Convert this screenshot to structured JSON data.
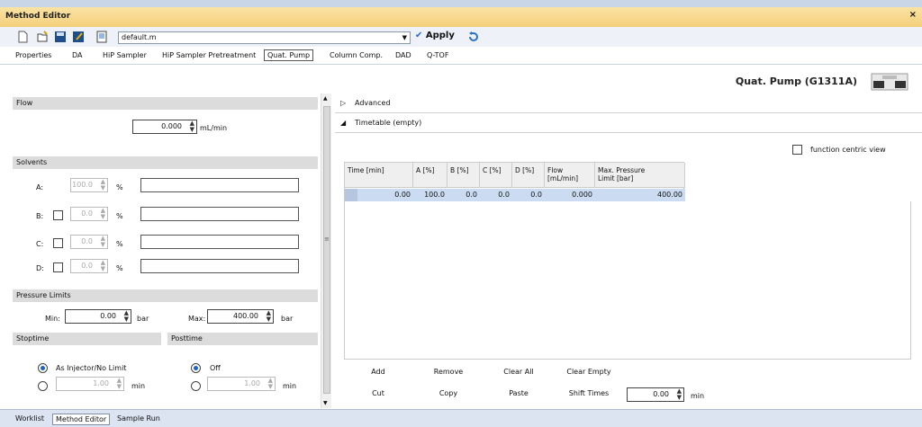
{
  "window": {
    "title": "Method Editor",
    "close_glyph": "×"
  },
  "toolbar": {
    "method_file": "default.m",
    "apply_label": "Apply",
    "icons": [
      "new-document-icon",
      "open-icon",
      "save-icon",
      "save-as-icon",
      "report-icon",
      "undo-icon"
    ]
  },
  "tabs": [
    {
      "label": "Properties",
      "active": false
    },
    {
      "label": "DA",
      "active": false
    },
    {
      "label": "HiP Sampler",
      "active": false
    },
    {
      "label": "HiP Sampler Pretreatment",
      "active": false
    },
    {
      "label": "Quat. Pump",
      "active": true
    },
    {
      "label": "Column Comp.",
      "active": false
    },
    {
      "label": "DAD",
      "active": false
    },
    {
      "label": "Q-TOF",
      "active": false
    }
  ],
  "module_title": "Quat. Pump (G1311A)",
  "flow": {
    "header": "Flow",
    "value": "0.000",
    "unit": "mL/min"
  },
  "solvents": {
    "header": "Solvents",
    "rows": [
      {
        "label": "A:",
        "value": "100.0",
        "unit": "%",
        "has_checkbox": false
      },
      {
        "label": "B:",
        "value": "0.0",
        "unit": "%",
        "has_checkbox": true
      },
      {
        "label": "C:",
        "value": "0.0",
        "unit": "%",
        "has_checkbox": true
      },
      {
        "label": "D:",
        "value": "0.0",
        "unit": "%",
        "has_checkbox": true
      }
    ]
  },
  "pressure": {
    "header": "Pressure Limits",
    "min_label": "Min:",
    "min_value": "0.00",
    "min_unit": "bar",
    "max_label": "Max:",
    "max_value": "400.00",
    "max_unit": "bar"
  },
  "stoptime": {
    "header": "Stoptime",
    "option1": "As Injector/No Limit",
    "value": "1.00",
    "unit": "min"
  },
  "posttime": {
    "header": "Posttime",
    "option1": "Off",
    "value": "1.00",
    "unit": "min"
  },
  "advanced_label": "Advanced",
  "timetable": {
    "label": "Timetable (empty)",
    "function_centric_label": "function centric view",
    "columns": [
      "Time [min]",
      "A [%]",
      "B [%]",
      "C [%]",
      "D [%]",
      "Flow\n[mL/min]",
      "Max. Pressure\nLimit [bar]"
    ],
    "row": [
      "0.00",
      "100.0",
      "0.0",
      "0.0",
      "0.0",
      "0.000",
      "400.00"
    ]
  },
  "buttons": {
    "add": "Add",
    "remove": "Remove",
    "clear_all": "Clear All",
    "clear_empty": "Clear Empty",
    "cut": "Cut",
    "copy": "Copy",
    "paste": "Paste",
    "shift_times": "Shift Times",
    "shift_value": "0.00",
    "shift_unit": "min"
  },
  "bottom_tabs": [
    {
      "label": "Worklist",
      "active": false
    },
    {
      "label": "Method Editor",
      "active": true
    },
    {
      "label": "Sample Run",
      "active": false
    }
  ]
}
